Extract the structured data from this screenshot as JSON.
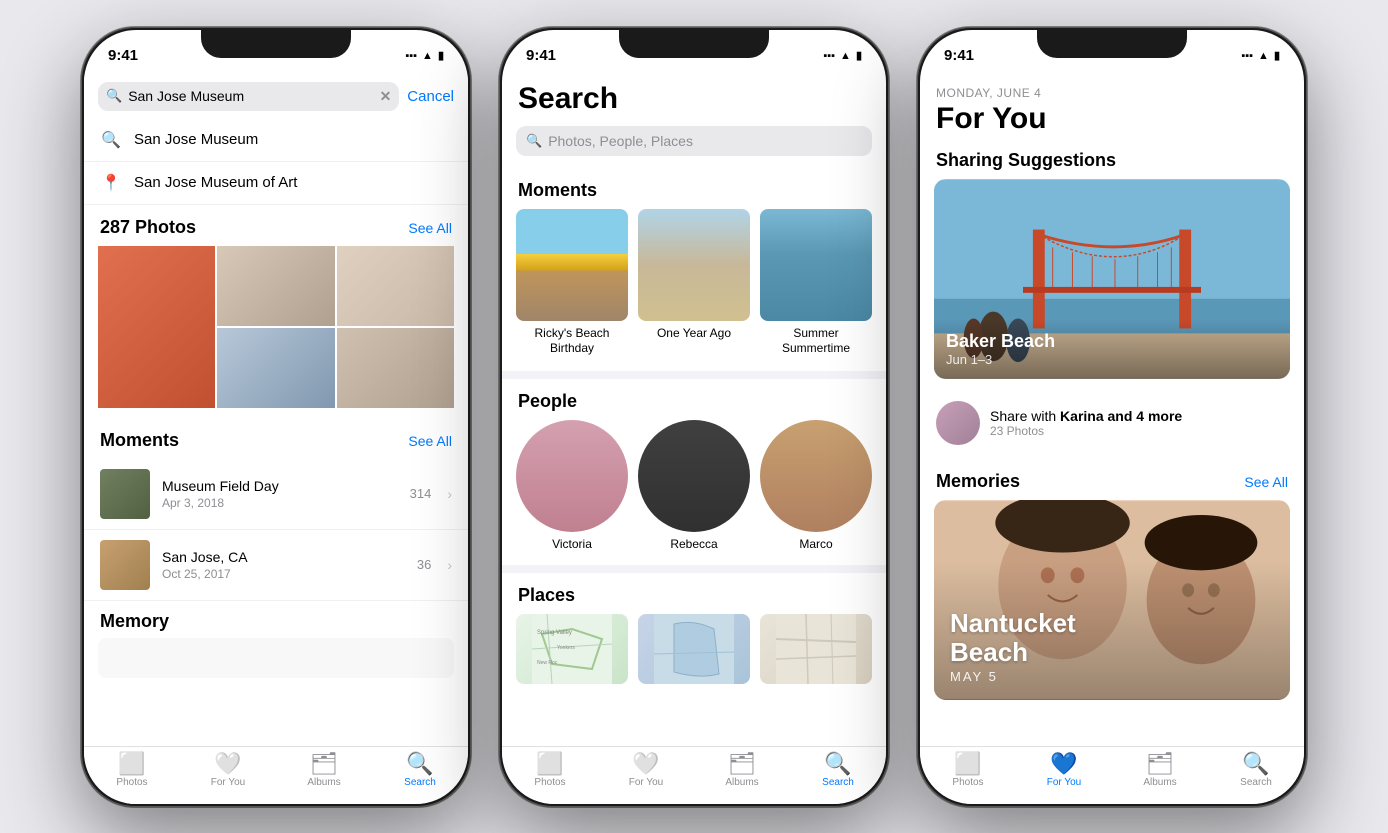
{
  "phone1": {
    "time": "9:41",
    "search_value": "San Jose Museum",
    "cancel_label": "Cancel",
    "suggestions": [
      {
        "icon": "🔍",
        "text": "San Jose Museum"
      },
      {
        "icon": "📍",
        "text": "San Jose Museum of Art"
      }
    ],
    "photos_section": {
      "title": "287 Photos",
      "see_all": "See All"
    },
    "moments_section": {
      "title": "Moments",
      "see_all": "See All",
      "items": [
        {
          "title": "Museum Field Day",
          "date": "Apr 3, 2018",
          "count": "314"
        },
        {
          "title": "San Jose, CA",
          "date": "Oct 25, 2017",
          "count": "36"
        }
      ]
    },
    "memory_section": {
      "title": "Memory"
    },
    "tabs": [
      {
        "label": "Photos",
        "icon": "⬜",
        "active": false
      },
      {
        "label": "For You",
        "icon": "❤️",
        "active": false
      },
      {
        "label": "Albums",
        "icon": "🗂",
        "active": false
      },
      {
        "label": "Search",
        "icon": "🔍",
        "active": true
      }
    ]
  },
  "phone2": {
    "time": "9:41",
    "page_title": "Search",
    "search_placeholder": "Photos, People, Places",
    "moments": {
      "title": "Moments",
      "items": [
        {
          "label": "Ricky's Beach Birthday"
        },
        {
          "label": "One Year Ago"
        },
        {
          "label": "Summer Summertime"
        }
      ]
    },
    "people": {
      "title": "People",
      "items": [
        {
          "name": "Victoria"
        },
        {
          "name": "Rebecca"
        },
        {
          "name": "Marco"
        }
      ]
    },
    "places": {
      "title": "Places"
    },
    "tabs": [
      {
        "label": "Photos",
        "icon": "⬜",
        "active": false
      },
      {
        "label": "For You",
        "icon": "❤️",
        "active": false
      },
      {
        "label": "Albums",
        "icon": "🗂",
        "active": false
      },
      {
        "label": "Search",
        "icon": "🔍",
        "active": true
      }
    ]
  },
  "phone3": {
    "time": "9:41",
    "date_label": "Monday, June 4",
    "page_title": "For You",
    "sharing": {
      "title": "Sharing Suggestions",
      "card": {
        "title": "Baker Beach",
        "date": "Jun 1–3"
      },
      "share_text": "Share with Karina and 4 more",
      "share_count": "23 Photos"
    },
    "memories": {
      "title": "Memories",
      "see_all": "See All",
      "card": {
        "title": "Nantucket\nBeach",
        "date": "MAY 5"
      }
    },
    "tabs": [
      {
        "label": "Photos",
        "icon": "⬜",
        "active": false
      },
      {
        "label": "For You",
        "icon": "❤️",
        "active": true
      },
      {
        "label": "Albums",
        "icon": "🗂",
        "active": false
      },
      {
        "label": "Search",
        "icon": "🔍",
        "active": false
      }
    ]
  }
}
